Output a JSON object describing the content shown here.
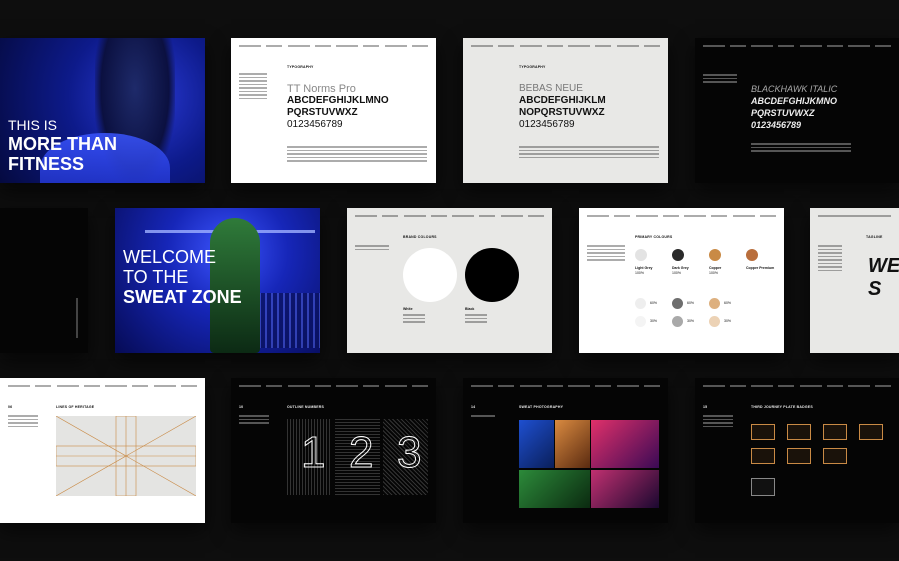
{
  "hero": {
    "line1": "THIS IS",
    "line2": "MORE THAN",
    "line3": "FITNESS"
  },
  "welcome": {
    "line1": "WELCOME",
    "line2": "TO THE",
    "line3": "SWEAT ZONE"
  },
  "typography": {
    "label": "TYPOGRAPHY",
    "font1": {
      "name": "TT Norms Pro",
      "upper1": "ABCDEFGHIJKLMNO",
      "upper2": "PQRSTUVWXZ",
      "digits": "0123456789"
    },
    "font2": {
      "name": "BEBAS NEUE",
      "upper1": "ABCDEFGHIJKLM",
      "upper2": "NOPQRSTUVWXZ",
      "digits": "0123456789"
    },
    "font3": {
      "name": "BLACKHAWK ITALIC",
      "upper1": "ABCDEFGHIJKMNO",
      "upper2": "PQRSTUVWXZ",
      "digits": "0123456789"
    }
  },
  "brand_colours": {
    "label": "BRAND COLOURS",
    "white": "White",
    "black": "Black"
  },
  "primary_colours": {
    "label": "PRIMARY COLOURS",
    "swatches": [
      {
        "name": "Light Grey",
        "pct": "100%",
        "color": "#e3e3e3"
      },
      {
        "name": "Dark Grey",
        "pct": "100%",
        "color": "#2a2a2a"
      },
      {
        "name": "Copper",
        "pct": "100%",
        "color": "#c98a45"
      },
      {
        "name": "Copper Premium",
        "pct": "",
        "color": "#b96e3c"
      }
    ],
    "tints": [
      "60%",
      "60%",
      "60%",
      "30%",
      "30%",
      "30%"
    ]
  },
  "tagline": {
    "label": "TAGLINE",
    "text": "WE S"
  },
  "lines_of_heritage": {
    "label": "LINES OF HERITAGE",
    "number": "06"
  },
  "outline_numbers": {
    "label": "OUTLINE NUMBERS",
    "number": "10",
    "digits": [
      "1",
      "2",
      "3"
    ]
  },
  "sweat_photography": {
    "label": "SWEAT PHOTOGRAPHY",
    "number": "14"
  },
  "third_journey": {
    "label": "THIRD JOURNEY PLATE BADGES",
    "number": "15"
  },
  "colors": {
    "blue": "#1a2fd6",
    "copper": "#c98a45",
    "bg": "#0e0e0e"
  }
}
